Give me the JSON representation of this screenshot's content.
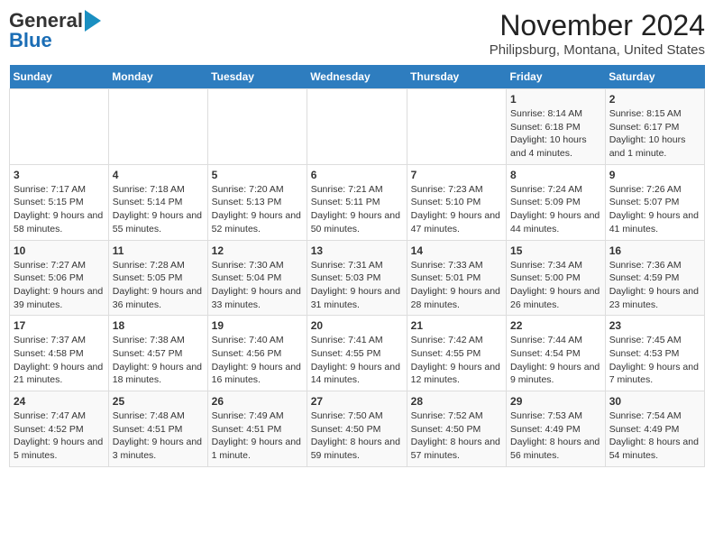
{
  "header": {
    "logo_line1": "General",
    "logo_line2": "Blue",
    "title": "November 2024",
    "subtitle": "Philipsburg, Montana, United States"
  },
  "weekdays": [
    "Sunday",
    "Monday",
    "Tuesday",
    "Wednesday",
    "Thursday",
    "Friday",
    "Saturday"
  ],
  "weeks": [
    [
      {
        "day": "",
        "info": ""
      },
      {
        "day": "",
        "info": ""
      },
      {
        "day": "",
        "info": ""
      },
      {
        "day": "",
        "info": ""
      },
      {
        "day": "",
        "info": ""
      },
      {
        "day": "1",
        "info": "Sunrise: 8:14 AM\nSunset: 6:18 PM\nDaylight: 10 hours and 4 minutes."
      },
      {
        "day": "2",
        "info": "Sunrise: 8:15 AM\nSunset: 6:17 PM\nDaylight: 10 hours and 1 minute."
      }
    ],
    [
      {
        "day": "3",
        "info": "Sunrise: 7:17 AM\nSunset: 5:15 PM\nDaylight: 9 hours and 58 minutes."
      },
      {
        "day": "4",
        "info": "Sunrise: 7:18 AM\nSunset: 5:14 PM\nDaylight: 9 hours and 55 minutes."
      },
      {
        "day": "5",
        "info": "Sunrise: 7:20 AM\nSunset: 5:13 PM\nDaylight: 9 hours and 52 minutes."
      },
      {
        "day": "6",
        "info": "Sunrise: 7:21 AM\nSunset: 5:11 PM\nDaylight: 9 hours and 50 minutes."
      },
      {
        "day": "7",
        "info": "Sunrise: 7:23 AM\nSunset: 5:10 PM\nDaylight: 9 hours and 47 minutes."
      },
      {
        "day": "8",
        "info": "Sunrise: 7:24 AM\nSunset: 5:09 PM\nDaylight: 9 hours and 44 minutes."
      },
      {
        "day": "9",
        "info": "Sunrise: 7:26 AM\nSunset: 5:07 PM\nDaylight: 9 hours and 41 minutes."
      }
    ],
    [
      {
        "day": "10",
        "info": "Sunrise: 7:27 AM\nSunset: 5:06 PM\nDaylight: 9 hours and 39 minutes."
      },
      {
        "day": "11",
        "info": "Sunrise: 7:28 AM\nSunset: 5:05 PM\nDaylight: 9 hours and 36 minutes."
      },
      {
        "day": "12",
        "info": "Sunrise: 7:30 AM\nSunset: 5:04 PM\nDaylight: 9 hours and 33 minutes."
      },
      {
        "day": "13",
        "info": "Sunrise: 7:31 AM\nSunset: 5:03 PM\nDaylight: 9 hours and 31 minutes."
      },
      {
        "day": "14",
        "info": "Sunrise: 7:33 AM\nSunset: 5:01 PM\nDaylight: 9 hours and 28 minutes."
      },
      {
        "day": "15",
        "info": "Sunrise: 7:34 AM\nSunset: 5:00 PM\nDaylight: 9 hours and 26 minutes."
      },
      {
        "day": "16",
        "info": "Sunrise: 7:36 AM\nSunset: 4:59 PM\nDaylight: 9 hours and 23 minutes."
      }
    ],
    [
      {
        "day": "17",
        "info": "Sunrise: 7:37 AM\nSunset: 4:58 PM\nDaylight: 9 hours and 21 minutes."
      },
      {
        "day": "18",
        "info": "Sunrise: 7:38 AM\nSunset: 4:57 PM\nDaylight: 9 hours and 18 minutes."
      },
      {
        "day": "19",
        "info": "Sunrise: 7:40 AM\nSunset: 4:56 PM\nDaylight: 9 hours and 16 minutes."
      },
      {
        "day": "20",
        "info": "Sunrise: 7:41 AM\nSunset: 4:55 PM\nDaylight: 9 hours and 14 minutes."
      },
      {
        "day": "21",
        "info": "Sunrise: 7:42 AM\nSunset: 4:55 PM\nDaylight: 9 hours and 12 minutes."
      },
      {
        "day": "22",
        "info": "Sunrise: 7:44 AM\nSunset: 4:54 PM\nDaylight: 9 hours and 9 minutes."
      },
      {
        "day": "23",
        "info": "Sunrise: 7:45 AM\nSunset: 4:53 PM\nDaylight: 9 hours and 7 minutes."
      }
    ],
    [
      {
        "day": "24",
        "info": "Sunrise: 7:47 AM\nSunset: 4:52 PM\nDaylight: 9 hours and 5 minutes."
      },
      {
        "day": "25",
        "info": "Sunrise: 7:48 AM\nSunset: 4:51 PM\nDaylight: 9 hours and 3 minutes."
      },
      {
        "day": "26",
        "info": "Sunrise: 7:49 AM\nSunset: 4:51 PM\nDaylight: 9 hours and 1 minute."
      },
      {
        "day": "27",
        "info": "Sunrise: 7:50 AM\nSunset: 4:50 PM\nDaylight: 8 hours and 59 minutes."
      },
      {
        "day": "28",
        "info": "Sunrise: 7:52 AM\nSunset: 4:50 PM\nDaylight: 8 hours and 57 minutes."
      },
      {
        "day": "29",
        "info": "Sunrise: 7:53 AM\nSunset: 4:49 PM\nDaylight: 8 hours and 56 minutes."
      },
      {
        "day": "30",
        "info": "Sunrise: 7:54 AM\nSunset: 4:49 PM\nDaylight: 8 hours and 54 minutes."
      }
    ]
  ]
}
